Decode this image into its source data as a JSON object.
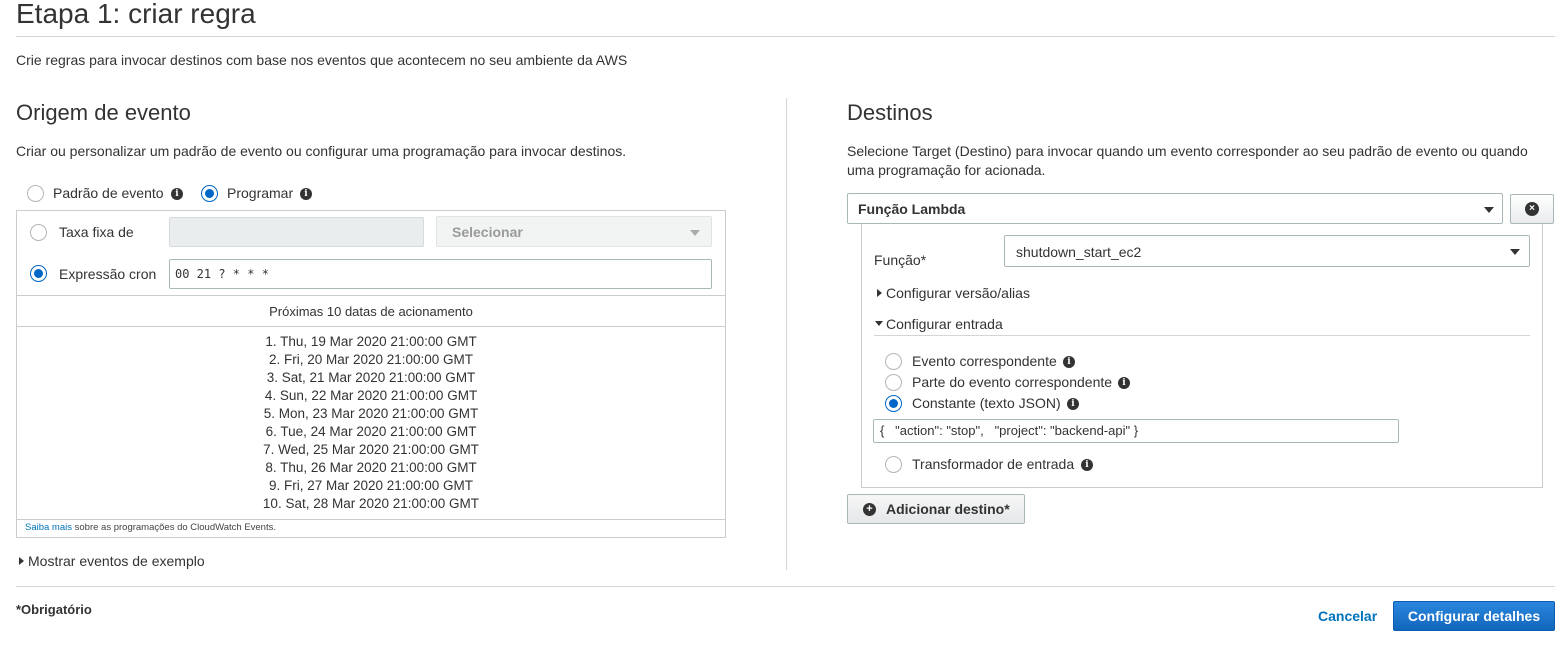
{
  "page": {
    "title": "Etapa 1: criar regra",
    "subtitle": "Crie regras para invocar destinos com base nos eventos que acontecem no seu ambiente da AWS"
  },
  "event_source": {
    "title": "Origem de evento",
    "description": "Criar ou personalizar um padrão de evento ou configurar uma programação para invocar destinos.",
    "options": {
      "event_pattern": "Padrão de evento",
      "schedule": "Programar"
    },
    "selected": "schedule",
    "schedule": {
      "fixed_rate_label": "Taxa fixa de",
      "fixed_rate_value": "",
      "unit_placeholder": "Selecionar",
      "cron_label": "Expressão cron",
      "cron_value": "00 21 ? * * *",
      "selected": "cron",
      "next_dates_header": "Próximas 10 datas de acionamento",
      "next_dates": [
        "1. Thu, 19 Mar 2020 21:00:00 GMT",
        "2. Fri, 20 Mar 2020 21:00:00 GMT",
        "3. Sat, 21 Mar 2020 21:00:00 GMT",
        "4. Sun, 22 Mar 2020 21:00:00 GMT",
        "5. Mon, 23 Mar 2020 21:00:00 GMT",
        "6. Tue, 24 Mar 2020 21:00:00 GMT",
        "7. Wed, 25 Mar 2020 21:00:00 GMT",
        "8. Thu, 26 Mar 2020 21:00:00 GMT",
        "9. Fri, 27 Mar 2020 21:00:00 GMT",
        "10. Sat, 28 Mar 2020 21:00:00 GMT"
      ],
      "learn_more_link": "Saiba mais",
      "learn_more_text": " sobre as programações do CloudWatch Events."
    },
    "show_examples": "Mostrar eventos de exemplo"
  },
  "targets": {
    "title": "Destinos",
    "description": "Selecione Target (Destino) para invocar quando um evento corresponder ao seu padrão de evento ou quando uma programação for acionada.",
    "target_type": "Função Lambda",
    "function_label": "Função*",
    "function_value": "shutdown_start_ec2",
    "configure_version": "Configurar versão/alias",
    "configure_input": "Configurar entrada",
    "input_options": {
      "matched_event": "Evento correspondente",
      "part_of_event": "Parte do evento correspondente",
      "constant_json": "Constante (texto JSON)",
      "input_transformer": "Transformador de entrada"
    },
    "input_selected": "constant_json",
    "json_value": "{   \"action\": \"stop\",   \"project\": \"backend-api\" }",
    "add_target": "Adicionar destino*"
  },
  "footer": {
    "required_note": "*Obrigatório",
    "cancel": "Cancelar",
    "configure_details": "Configurar detalhes"
  },
  "icons": {
    "info": "info-icon",
    "remove": "remove-circle-icon",
    "add": "plus-circle-icon"
  },
  "colors": {
    "accent": "#0066c7",
    "link": "#0073bb",
    "primary_button": "#1a73c9"
  }
}
